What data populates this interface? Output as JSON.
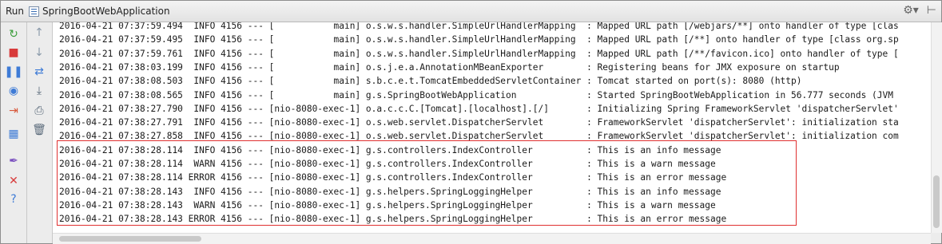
{
  "titlebar": {
    "run_label": "Run",
    "config_name": "SpringBootWebApplication",
    "config_icon": "app-config-icon",
    "settings_icon": "gear-icon",
    "settings_glyph": "⚙▾",
    "pin_icon": "pin-icon",
    "pin_glyph": "⊢"
  },
  "toolbar_left": [
    {
      "name": "rerun-icon",
      "glyph": "↻",
      "color": "#3a9d3a"
    },
    {
      "name": "stop-icon",
      "glyph": "■",
      "color": "#d83b3b"
    },
    {
      "name": "pause-icon",
      "glyph": "❚❚",
      "color": "#3e7bd6"
    },
    {
      "name": "dump-threads-icon",
      "glyph": "◉",
      "color": "#3e7bd6"
    },
    {
      "name": "exit-icon",
      "glyph": "⇥",
      "color": "#d8583b"
    },
    {
      "name": "layout-icon",
      "glyph": "▦",
      "color": "#3e7bd6"
    },
    {
      "name": "pin-tab-icon",
      "glyph": "✒",
      "color": "#7a4fbf"
    },
    {
      "name": "close-icon",
      "glyph": "✕",
      "color": "#d83b3b"
    },
    {
      "name": "help-icon",
      "glyph": "?",
      "color": "#3e7bd6"
    }
  ],
  "toolbar_right": [
    {
      "name": "scroll-up-icon",
      "glyph": "↑",
      "color": "#8a9aaa"
    },
    {
      "name": "scroll-down-icon",
      "glyph": "↓",
      "color": "#8a9aaa"
    },
    {
      "name": "soft-wrap-icon",
      "glyph": "⇄",
      "color": "#3e7bd6"
    },
    {
      "name": "scroll-to-end-icon",
      "glyph": "⤓",
      "color": "#5a6a7a"
    },
    {
      "name": "print-icon",
      "glyph": "⎙",
      "color": "#5a6a7a"
    },
    {
      "name": "clear-all-icon",
      "glyph": "🗑",
      "color": "#5a6a7a"
    }
  ],
  "console": {
    "lines": [
      "2016-04-21 07:37:59.494  INFO 4156 --- [           main] o.s.w.s.handler.SimpleUrlHandlerMapping  : Mapped URL path [/webjars/**] onto handler of type [clas",
      "2016-04-21 07:37:59.495  INFO 4156 --- [           main] o.s.w.s.handler.SimpleUrlHandlerMapping  : Mapped URL path [/**] onto handler of type [class org.sp",
      "2016-04-21 07:37:59.761  INFO 4156 --- [           main] o.s.w.s.handler.SimpleUrlHandlerMapping  : Mapped URL path [/**/favicon.ico] onto handler of type [",
      "2016-04-21 07:38:03.199  INFO 4156 --- [           main] o.s.j.e.a.AnnotationMBeanExporter        : Registering beans for JMX exposure on startup",
      "2016-04-21 07:38:08.503  INFO 4156 --- [           main] s.b.c.e.t.TomcatEmbeddedServletContainer : Tomcat started on port(s): 8080 (http)",
      "2016-04-21 07:38:08.565  INFO 4156 --- [           main] g.s.SpringBootWebApplication             : Started SpringBootWebApplication in 56.777 seconds (JVM",
      "2016-04-21 07:38:27.790  INFO 4156 --- [nio-8080-exec-1] o.a.c.c.C.[Tomcat].[localhost].[/]       : Initializing Spring FrameworkServlet 'dispatcherServlet'",
      "2016-04-21 07:38:27.791  INFO 4156 --- [nio-8080-exec-1] o.s.web.servlet.DispatcherServlet        : FrameworkServlet 'dispatcherServlet': initialization sta",
      "2016-04-21 07:38:27.858  INFO 4156 --- [nio-8080-exec-1] o.s.web.servlet.DispatcherServlet        : FrameworkServlet 'dispatcherServlet': initialization com",
      "2016-04-21 07:38:28.114  INFO 4156 --- [nio-8080-exec-1] g.s.controllers.IndexController          : This is an info message",
      "2016-04-21 07:38:28.114  WARN 4156 --- [nio-8080-exec-1] g.s.controllers.IndexController          : This is a warn message",
      "2016-04-21 07:38:28.114 ERROR 4156 --- [nio-8080-exec-1] g.s.controllers.IndexController          : This is an error message",
      "2016-04-21 07:38:28.143  INFO 4156 --- [nio-8080-exec-1] g.s.helpers.SpringLoggingHelper          : This is an info message",
      "2016-04-21 07:38:28.143  WARN 4156 --- [nio-8080-exec-1] g.s.helpers.SpringLoggingHelper          : This is a warn message",
      "2016-04-21 07:38:28.143 ERROR 4156 --- [nio-8080-exec-1] g.s.helpers.SpringLoggingHelper          : This is an error message"
    ]
  },
  "colors": {
    "highlight_border": "#e03030",
    "console_text": "#1a1a1a"
  }
}
